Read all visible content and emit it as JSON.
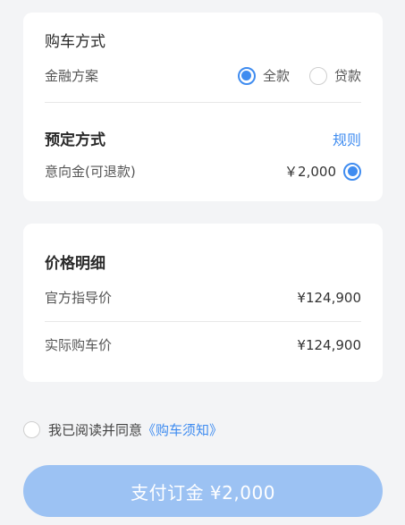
{
  "purchase": {
    "title": "购车方式",
    "finance_label": "金融方案",
    "options": [
      {
        "label": "全款",
        "checked": true
      },
      {
        "label": "贷款",
        "checked": false
      }
    ]
  },
  "reservation": {
    "title": "预定方式",
    "rules_link": "规则",
    "deposit_label": "意向金(可退款)",
    "deposit_value": "￥2,000",
    "deposit_checked": true
  },
  "price_detail": {
    "title": "价格明细",
    "rows": [
      {
        "label": "官方指导价",
        "value": "¥124,900"
      },
      {
        "label": "实际购车价",
        "value": "¥124,900"
      }
    ]
  },
  "agreement": {
    "prefix": "我已阅读并同意",
    "link": "《购车须知》",
    "checked": false
  },
  "pay_button": {
    "label": "支付订金 ¥2,000"
  },
  "colors": {
    "accent": "#3f8cf0",
    "button": "#9cc2f3",
    "background": "#f3f4f6"
  }
}
